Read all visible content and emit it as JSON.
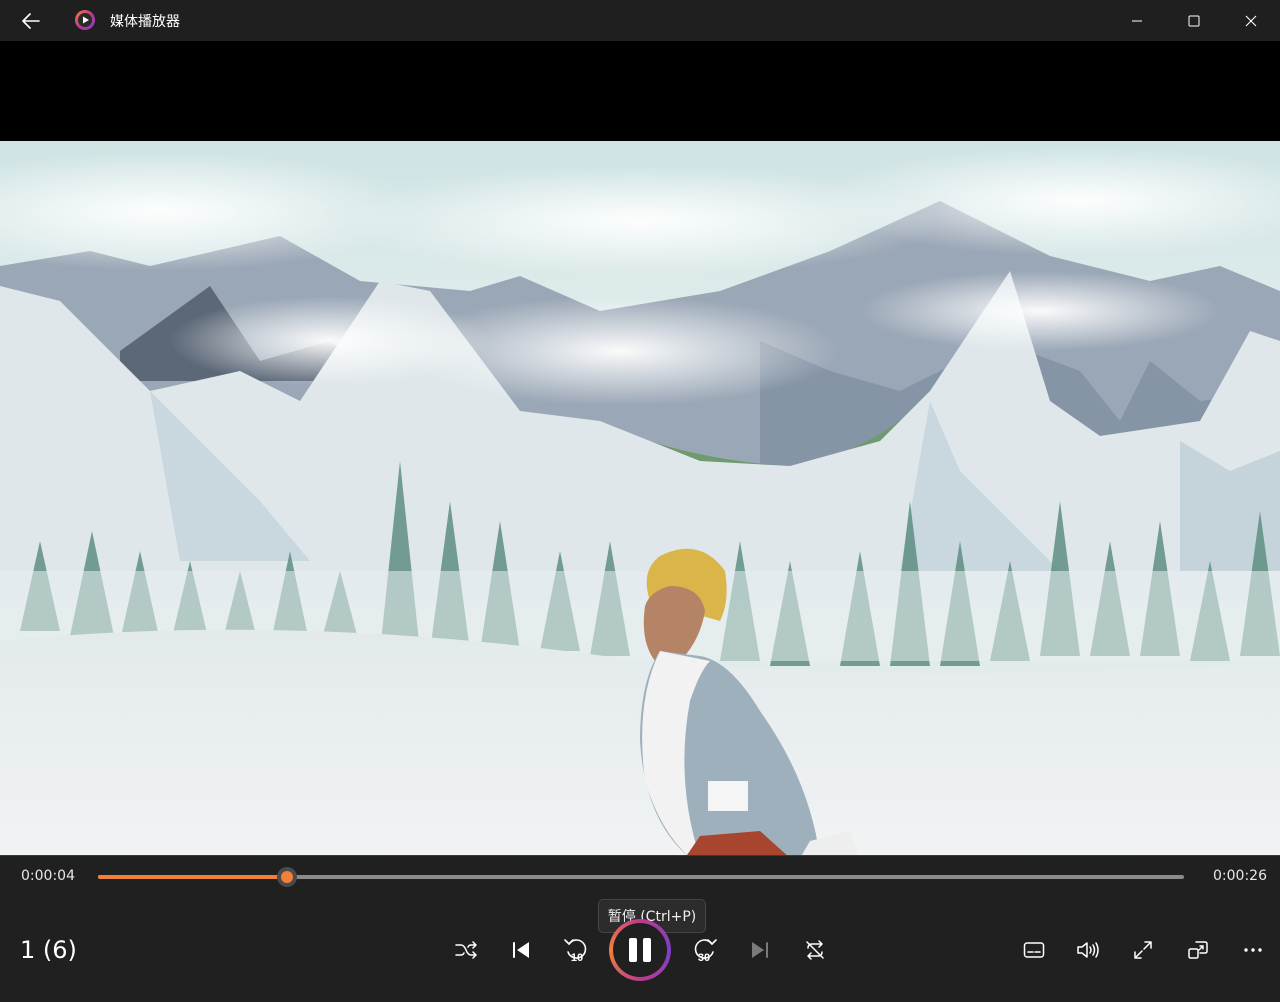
{
  "window": {
    "title": "媒体播放器"
  },
  "player": {
    "current_time": "0:00:04",
    "total_time": "0:00:26",
    "progress": 0.174,
    "tooltip": "暂停 (Ctrl+P)",
    "track_label": "1 (6)"
  },
  "colors": {
    "accent": "#f0813a",
    "titlebar_bg": "#1f1f1f",
    "controls_bg": "#202020"
  },
  "icons": {
    "shuffle": "shuffle-icon",
    "previous": "previous-icon",
    "skip_back": "skip-back-10-icon",
    "pause": "pause-icon",
    "skip_forward": "skip-forward-30-icon",
    "next": "next-icon",
    "repeat": "repeat-icon",
    "subtitles": "subtitles-icon",
    "volume": "volume-icon",
    "fullscreen": "fullscreen-icon",
    "mini_player": "mini-player-icon",
    "more": "more-icon"
  },
  "skip_labels": {
    "back": "10",
    "forward": "30"
  }
}
